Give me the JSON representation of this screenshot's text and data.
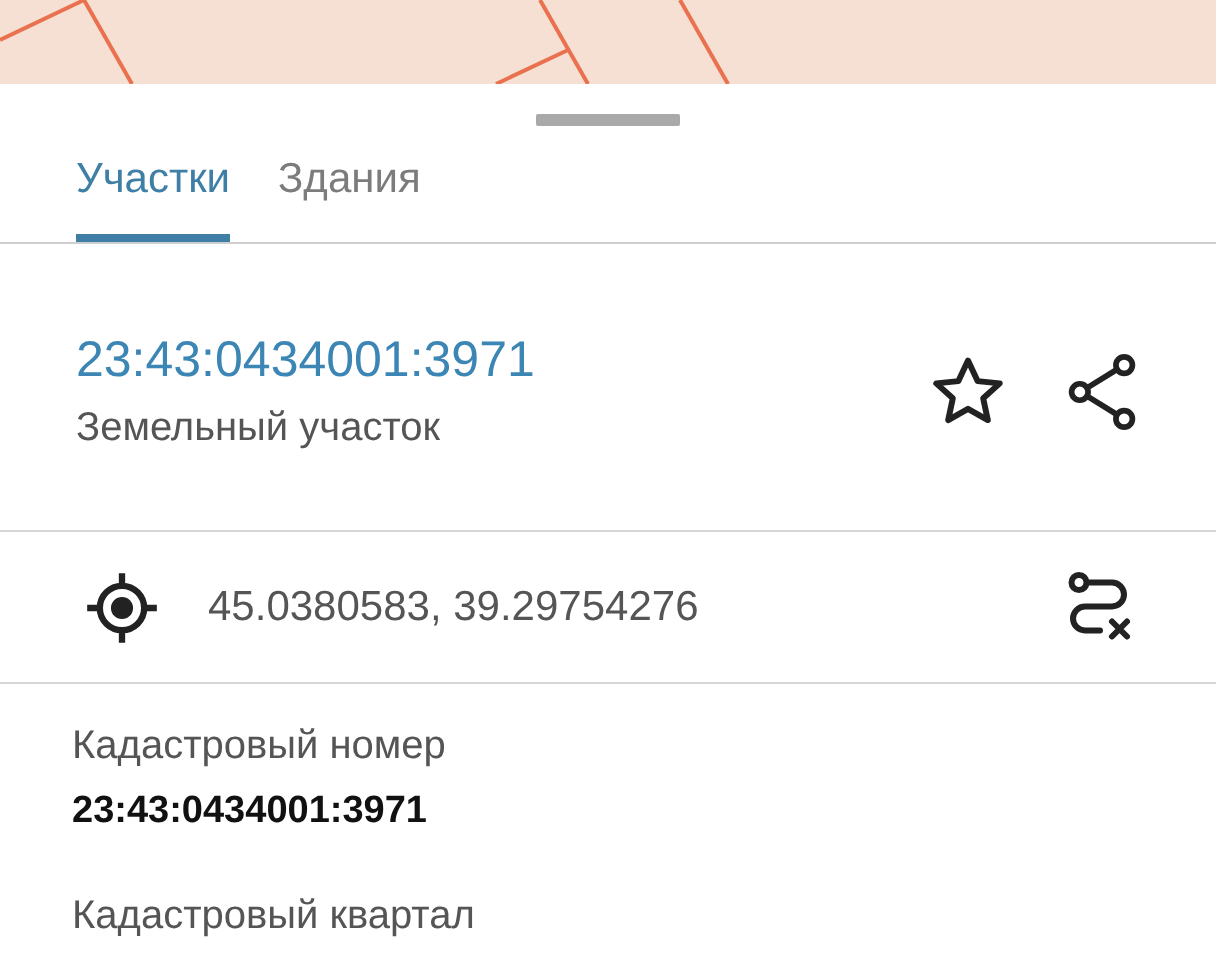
{
  "tabs": [
    {
      "label": "Участки",
      "selected": true
    },
    {
      "label": "Здания",
      "selected": false
    }
  ],
  "parcel": {
    "number": "23:43:0434001:3971",
    "type": "Земельный участок"
  },
  "coordinates": "45.0380583, 39.29754276",
  "fields": [
    {
      "label": "Кадастровый номер",
      "value": "23:43:0434001:3971"
    },
    {
      "label": "Кадастровый квартал"
    }
  ]
}
